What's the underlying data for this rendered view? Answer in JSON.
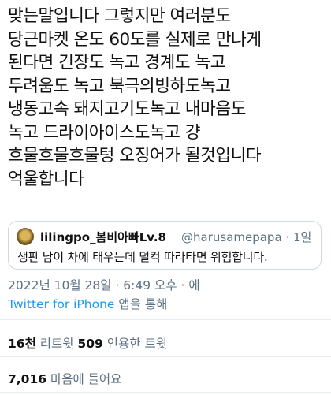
{
  "tweet": {
    "text": "맞는말입니다 그렇지만 여러분도\n당근마켓 온도 60도를 실제로 만나게\n된다면 긴장도 녹고 경계도 녹고\n두려움도 녹고 북극의빙하도녹고\n냉동고속 돼지고기도녹고 내마음도\n녹고 드라이아이스도녹고 걍\n흐물흐물흐물텅 오징어가 될것입니다\n억울합니다"
  },
  "quoted": {
    "name": "lilingpo_봄비아빠Lv.8",
    "handle": "@harusamepapa · 1일",
    "text": "생판 남이 차에 태우는데 덜컥 따라타면 위험합니다."
  },
  "meta": {
    "timestamp": "2022년 10월 28일 · 6:49 오후 · 에",
    "source": "Twitter for iPhone",
    "via": " 앱을 통해"
  },
  "stats": {
    "retweets_count": "16천",
    "retweets_label": " 리트윗  ",
    "quotes_count": "509",
    "quotes_label": " 인용한 트윗",
    "likes_count": "7,016",
    "likes_label": " 마음에 들어요"
  }
}
